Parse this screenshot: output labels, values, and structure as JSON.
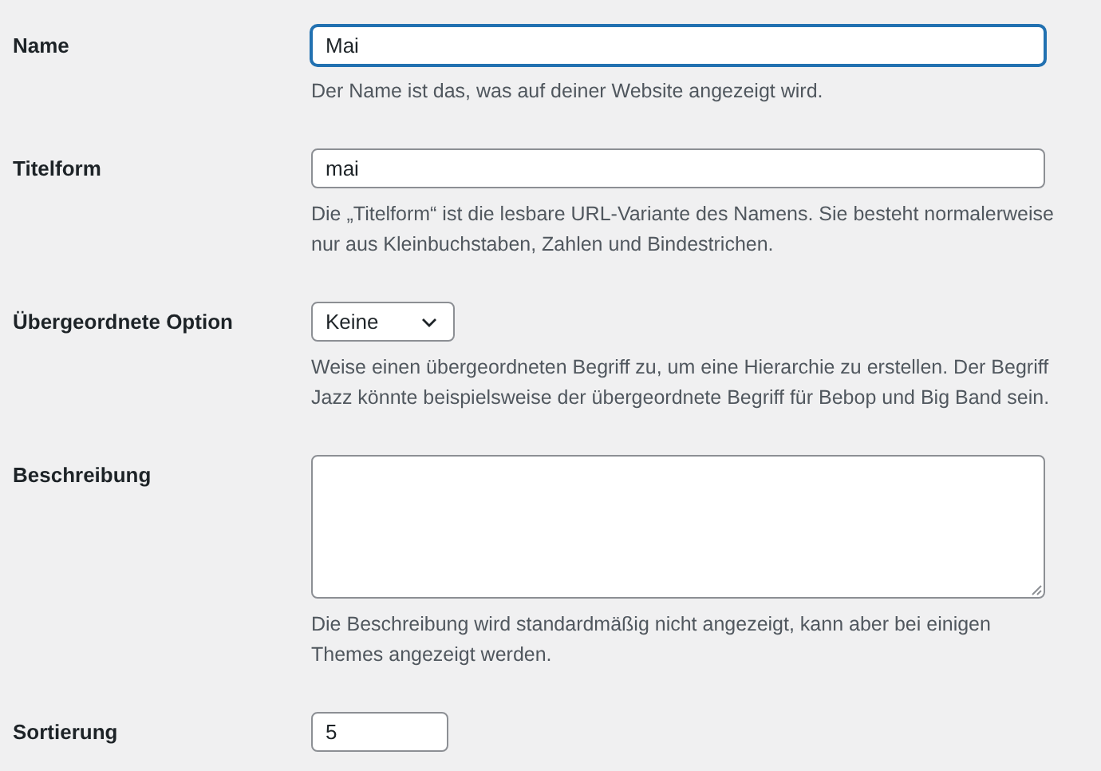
{
  "fields": [
    {
      "label": "Name",
      "kind": "text",
      "value": "Mai",
      "focused": true,
      "help": "Der Name ist das, was auf deiner Website angezeigt wird."
    },
    {
      "label": "Titelform",
      "kind": "text",
      "value": "mai",
      "focused": false,
      "help": "Die „Titelform“ ist die lesbare URL-Variante des Namens. Sie besteht normalerweise nur aus Kleinbuchstaben, Zahlen und Bindestrichen."
    },
    {
      "label": "Übergeordnete Option",
      "kind": "select",
      "value": "Keine",
      "focused": false,
      "help": "Weise einen übergeordneten Begriff zu, um eine Hierarchie zu erstellen. Der Begriff Jazz könnte beispielsweise der übergeordnete Begriff für Bebop und Big Band sein."
    },
    {
      "label": "Beschreibung",
      "kind": "textarea",
      "focused": false,
      "help": "Die Beschreibung wird standardmäßig nicht angezeigt, kann aber bei einigen Themes angezeigt werden."
    },
    {
      "label": "Sortierung",
      "kind": "number",
      "value": "5",
      "focused": false
    }
  ]
}
